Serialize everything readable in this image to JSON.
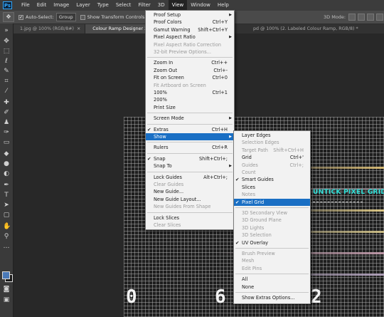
{
  "app": {
    "logo": "Ps"
  },
  "menubar": [
    {
      "label": "File"
    },
    {
      "label": "Edit"
    },
    {
      "label": "Image"
    },
    {
      "label": "Layer"
    },
    {
      "label": "Type"
    },
    {
      "label": "Select"
    },
    {
      "label": "Filter"
    },
    {
      "label": "3D"
    },
    {
      "label": "View",
      "active": true
    },
    {
      "label": "Window"
    },
    {
      "label": "Help"
    }
  ],
  "options": {
    "auto_select_label": "Auto-Select:",
    "auto_select_value": "Group",
    "transform_label": "Show Transform Controls",
    "mode3d_label": "3D Mode:"
  },
  "tabs": [
    {
      "label": "1.jpg @ 100% (RGB/8#)",
      "active": false
    },
    {
      "label": "Colour Ramp Designer 2.psd @",
      "active": true
    }
  ],
  "tab_right": "pd @ 100% (2. Labeled Colour Ramp, RGB/8) *",
  "view_menu": [
    {
      "label": "Proof Setup",
      "shortcut": "",
      "submenu": true
    },
    {
      "label": "Proof Colors",
      "shortcut": "Ctrl+Y"
    },
    {
      "label": "Gamut Warning",
      "shortcut": "Shift+Ctrl+Y"
    },
    {
      "label": "Pixel Aspect Ratio",
      "shortcut": "",
      "submenu": true
    },
    {
      "label": "Pixel Aspect Ratio Correction",
      "disabled": true
    },
    {
      "label": "32-bit Preview Options...",
      "disabled": true
    },
    {
      "sep": true
    },
    {
      "label": "Zoom In",
      "shortcut": "Ctrl++"
    },
    {
      "label": "Zoom Out",
      "shortcut": "Ctrl+-"
    },
    {
      "label": "Fit on Screen",
      "shortcut": "Ctrl+0"
    },
    {
      "label": "Fit Artboard on Screen",
      "disabled": true
    },
    {
      "label": "100%",
      "shortcut": "Ctrl+1"
    },
    {
      "label": "200%"
    },
    {
      "label": "Print Size"
    },
    {
      "sep": true
    },
    {
      "label": "Screen Mode",
      "submenu": true
    },
    {
      "sep": true
    },
    {
      "label": "Extras",
      "shortcut": "Ctrl+H",
      "checked": true
    },
    {
      "label": "Show",
      "submenu": true,
      "highlighted": true
    },
    {
      "sep": true
    },
    {
      "label": "Rulers",
      "shortcut": "Ctrl+R"
    },
    {
      "sep": true
    },
    {
      "label": "Snap",
      "shortcut": "Shift+Ctrl+;",
      "checked": true
    },
    {
      "label": "Snap To",
      "submenu": true
    },
    {
      "sep": true
    },
    {
      "label": "Lock Guides",
      "shortcut": "Alt+Ctrl+;"
    },
    {
      "label": "Clear Guides",
      "disabled": true
    },
    {
      "label": "New Guide..."
    },
    {
      "label": "New Guide Layout..."
    },
    {
      "label": "New Guides From Shape",
      "disabled": true
    },
    {
      "sep": true
    },
    {
      "label": "Lock Slices"
    },
    {
      "label": "Clear Slices",
      "disabled": true
    }
  ],
  "show_submenu": [
    {
      "label": "Layer Edges"
    },
    {
      "label": "Selection Edges",
      "disabled": true
    },
    {
      "label": "Target Path",
      "shortcut": "Shift+Ctrl+H",
      "disabled": true
    },
    {
      "label": "Grid",
      "shortcut": "Ctrl+'"
    },
    {
      "label": "Guides",
      "shortcut": "Ctrl+;",
      "disabled": true
    },
    {
      "label": "Count",
      "disabled": true
    },
    {
      "label": "Smart Guides",
      "checked": true
    },
    {
      "label": "Slices"
    },
    {
      "label": "Notes",
      "disabled": true
    },
    {
      "label": "Pixel Grid",
      "checked": true,
      "highlighted": true
    },
    {
      "sep": true
    },
    {
      "label": "3D Secondary View",
      "disabled": true
    },
    {
      "label": "3D Ground Plane",
      "disabled": true
    },
    {
      "label": "3D Lights",
      "disabled": true
    },
    {
      "label": "3D Selection",
      "disabled": true
    },
    {
      "label": "UV Overlay",
      "checked": true
    },
    {
      "sep": true
    },
    {
      "label": "Brush Preview",
      "disabled": true
    },
    {
      "label": "Mesh",
      "disabled": true
    },
    {
      "label": "Edit Pins",
      "disabled": true
    },
    {
      "sep": true
    },
    {
      "label": "All"
    },
    {
      "label": "None"
    },
    {
      "sep": true
    },
    {
      "label": "Show Extras Options..."
    }
  ],
  "annotation": "UNTICK PIXEL GRID",
  "canvas_digits": [
    "0",
    "6",
    "2"
  ],
  "colors": {
    "highlight": "#1a6fc4",
    "annotation": "#2fe0d8",
    "menu_bg": "#f2f2f2"
  }
}
